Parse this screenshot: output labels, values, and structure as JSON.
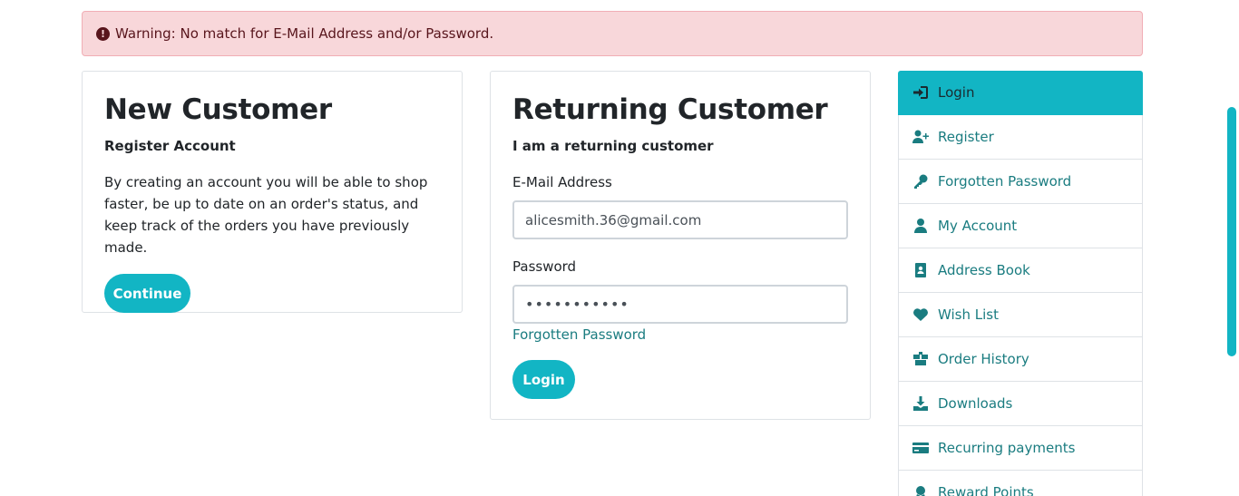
{
  "alert": {
    "icon": "exclamation-circle-icon",
    "text": "Warning: No match for E-Mail Address and/or Password."
  },
  "new_customer": {
    "title": "New Customer",
    "subtitle": "Register Account",
    "description": "By creating an account you will be able to shop faster, be up to date on an order's status, and keep track of the orders you have previously made.",
    "continue_label": "Continue"
  },
  "returning_customer": {
    "title": "Returning Customer",
    "subtitle": "I am a returning customer",
    "email_label": "E-Mail Address",
    "email_value": "alicesmith.36@gmail.com",
    "password_label": "Password",
    "password_value": "•••••••••••",
    "forgot_label": "Forgotten Password",
    "login_label": "Login"
  },
  "sidebar": {
    "items": [
      {
        "label": "Login",
        "icon": "sign-in-icon",
        "active": true
      },
      {
        "label": "Register",
        "icon": "user-plus-icon"
      },
      {
        "label": "Forgotten Password",
        "icon": "key-icon"
      },
      {
        "label": "My Account",
        "icon": "user-icon"
      },
      {
        "label": "Address Book",
        "icon": "address-book-icon"
      },
      {
        "label": "Wish List",
        "icon": "heart-icon"
      },
      {
        "label": "Order History",
        "icon": "boxes-icon"
      },
      {
        "label": "Downloads",
        "icon": "download-icon"
      },
      {
        "label": "Recurring payments",
        "icon": "credit-card-icon"
      },
      {
        "label": "Reward Points",
        "icon": "award-icon"
      }
    ]
  },
  "colors": {
    "accent": "#12b5c4",
    "link": "#1a7c80",
    "alert_bg": "#f8d7da",
    "alert_text": "#58151c"
  }
}
